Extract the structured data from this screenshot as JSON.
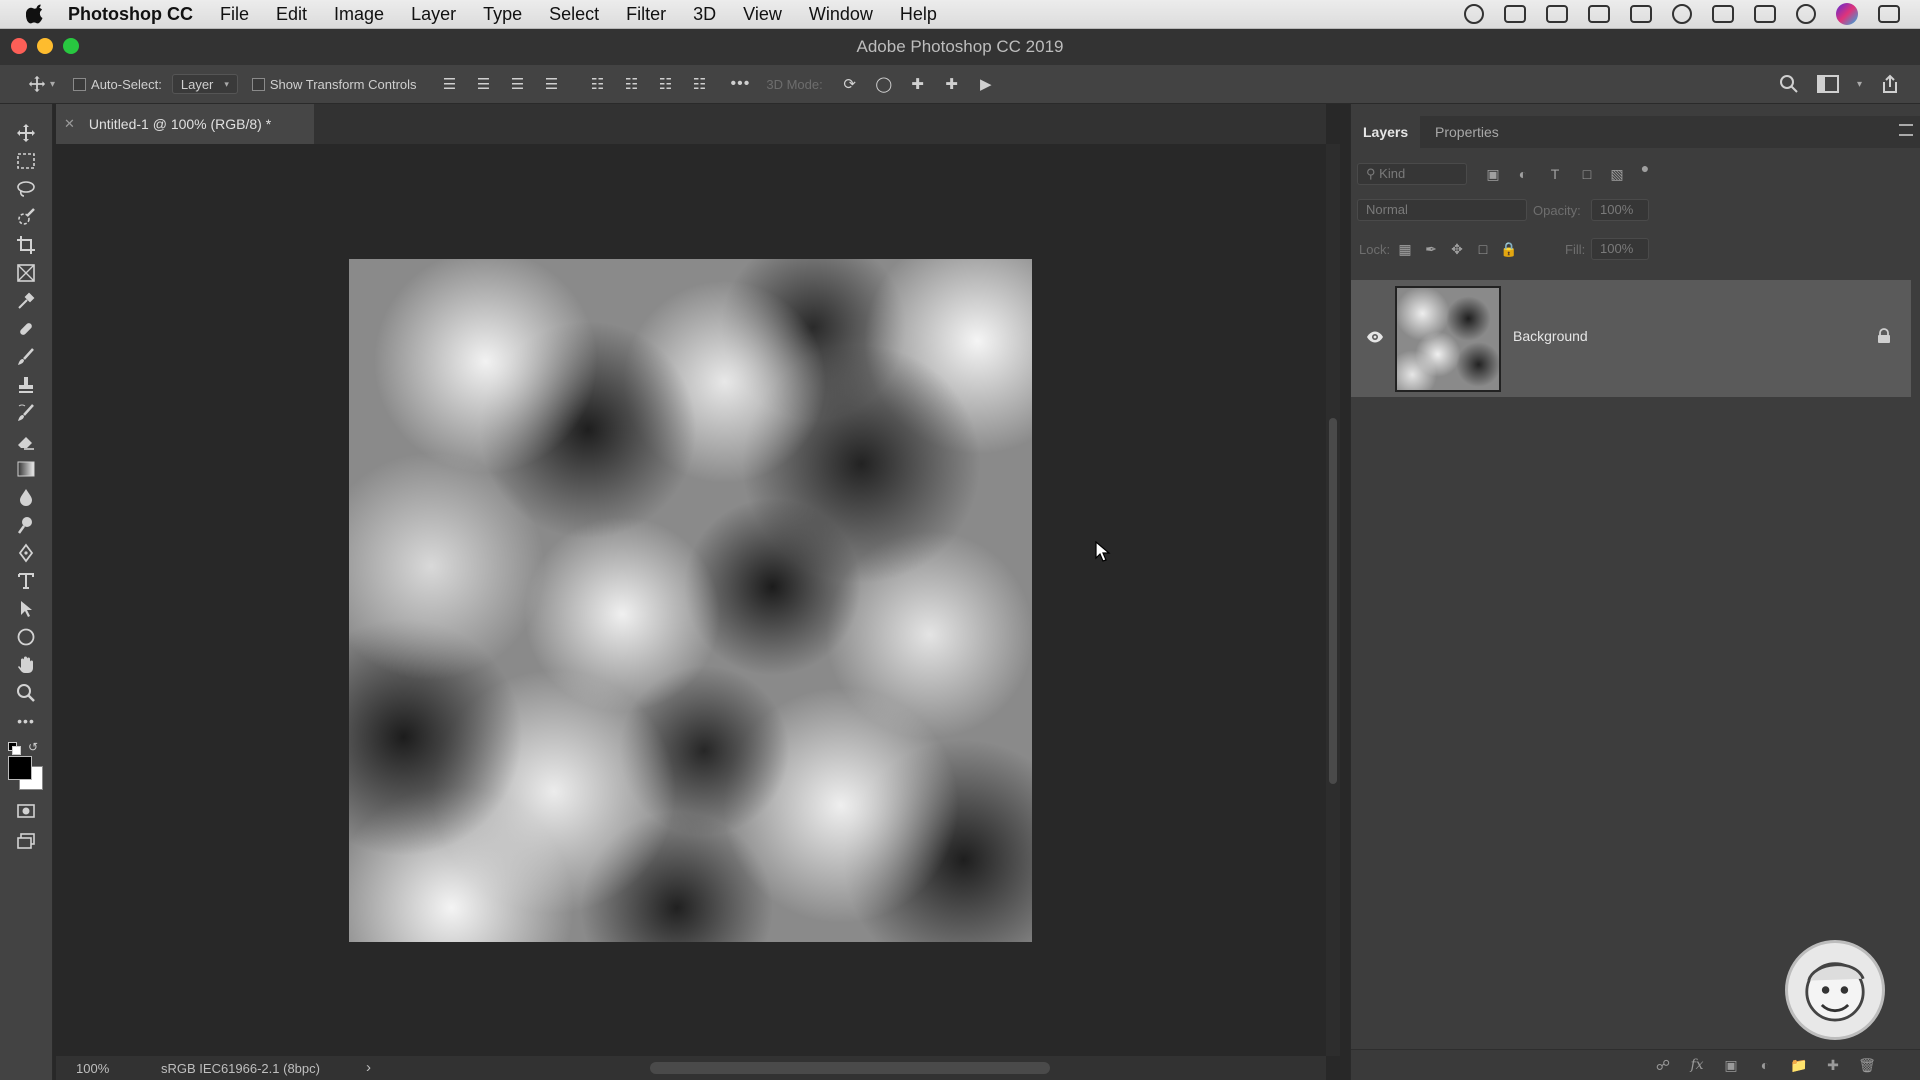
{
  "menubar": {
    "app_name": "Photoshop CC",
    "items": [
      "File",
      "Edit",
      "Image",
      "Layer",
      "Type",
      "Select",
      "Filter",
      "3D",
      "View",
      "Window",
      "Help"
    ]
  },
  "window": {
    "title": "Adobe Photoshop CC 2019"
  },
  "options_bar": {
    "auto_select_label": "Auto-Select:",
    "auto_select_target": "Layer",
    "show_transform_label": "Show Transform Controls",
    "three_d_mode_label": "3D Mode:"
  },
  "document": {
    "tab_title": "Untitled-1 @ 100% (RGB/8) *"
  },
  "status_bar": {
    "zoom": "100%",
    "color_profile": "sRGB IEC61966-2.1 (8bpc)"
  },
  "layers_panel": {
    "tabs": [
      "Layers",
      "Properties"
    ],
    "filter_placeholder": "Kind",
    "blend_mode": "Normal",
    "opacity_label": "Opacity:",
    "opacity_value": "100%",
    "lock_label": "Lock:",
    "fill_label": "Fill:",
    "fill_value": "100%",
    "layers": [
      {
        "name": "Background",
        "visible": true,
        "locked": true
      }
    ]
  }
}
